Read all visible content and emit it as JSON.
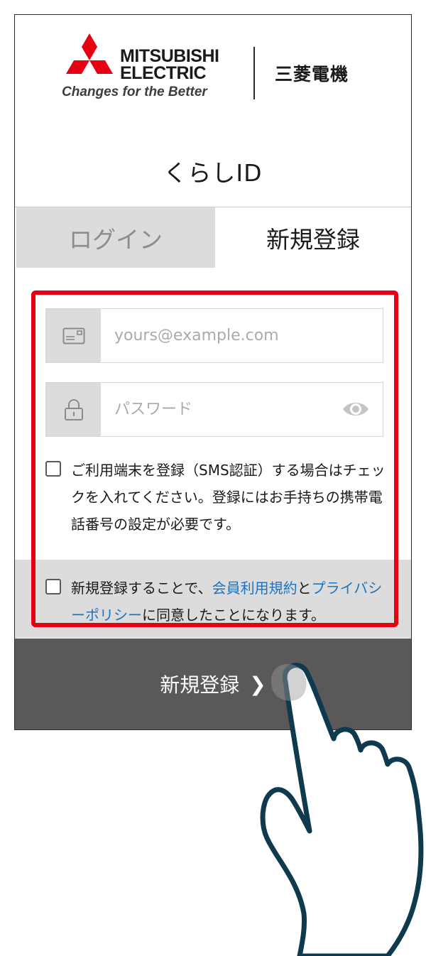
{
  "brand": {
    "logo_line1": "MITSUBISHI",
    "logo_line2": "ELECTRIC",
    "slogan": "Changes for the Better",
    "japanese_name": "三菱電機",
    "color": "#e60012"
  },
  "service_title": "くらしID",
  "tabs": [
    {
      "label": "ログイン",
      "active": false
    },
    {
      "label": "新規登録",
      "active": true
    }
  ],
  "email": {
    "placeholder": "yours@example.com",
    "value": "",
    "icon": "envelope-icon"
  },
  "password": {
    "placeholder": "パスワード",
    "value": "",
    "icon": "lock-icon",
    "toggle_icon": "eye-icon"
  },
  "sms_check": {
    "checked": false,
    "text": "ご利用端末を登録（SMS認証）する場合はチェックを入れてください。登録にはお手持ちの携帯電話番号の設定が必要です。"
  },
  "agree_check": {
    "checked": false,
    "prefix": "新規登録することで、",
    "terms_link": "会員利用規約",
    "middle": "と",
    "privacy_link": "プライバシーポリシー",
    "suffix": "に同意したことになります。",
    "link_color": "#1e73be"
  },
  "submit": {
    "label": "新規登録",
    "icon": "chevron-right-icon"
  },
  "colors": {
    "highlight": "#e60012",
    "tab_inactive_bg": "#dcdcdc",
    "button_bg": "#5a5858"
  }
}
